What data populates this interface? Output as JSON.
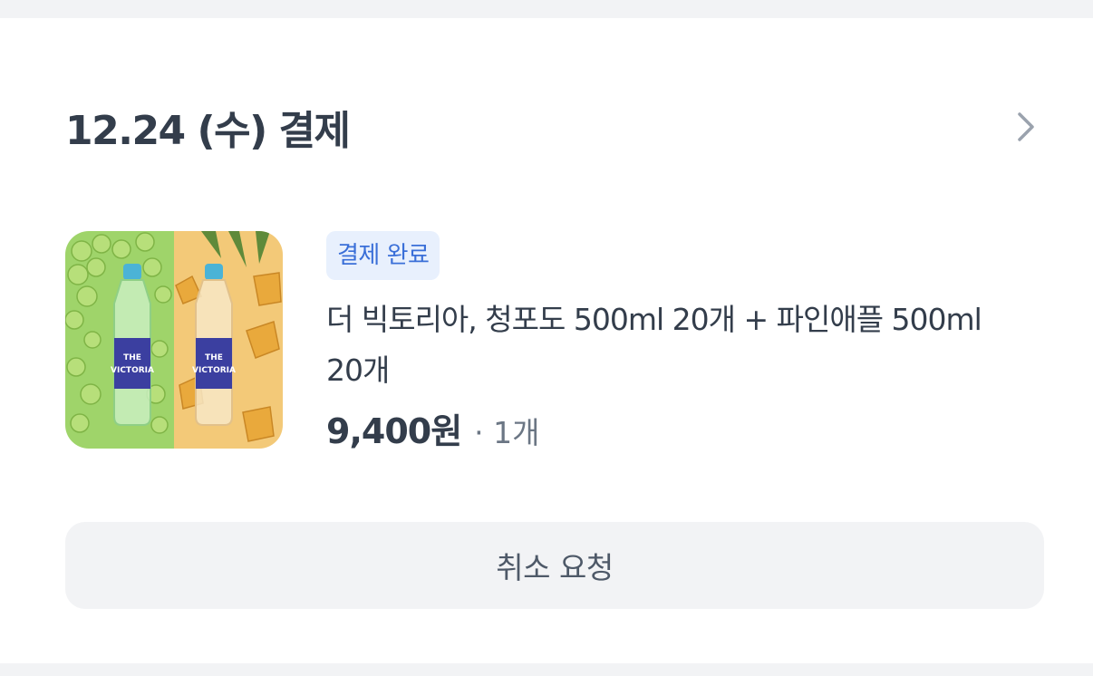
{
  "order": {
    "title": "12.24 (수) 결제",
    "chevron_icon": "chevron-right-icon",
    "status_badge": "결제 완료",
    "product_name": "더 빅토리아, 청포도 500ml 20개 + 파인애플 500ml 20개",
    "price": "9,400원",
    "quantity": "· 1개",
    "cancel_button": "취소 요청",
    "colors": {
      "badge_bg": "#e8f0fd",
      "badge_text": "#3a6fd8",
      "text_primary": "#333d4b",
      "text_secondary": "#6b7684",
      "button_bg": "#f2f3f5"
    }
  }
}
